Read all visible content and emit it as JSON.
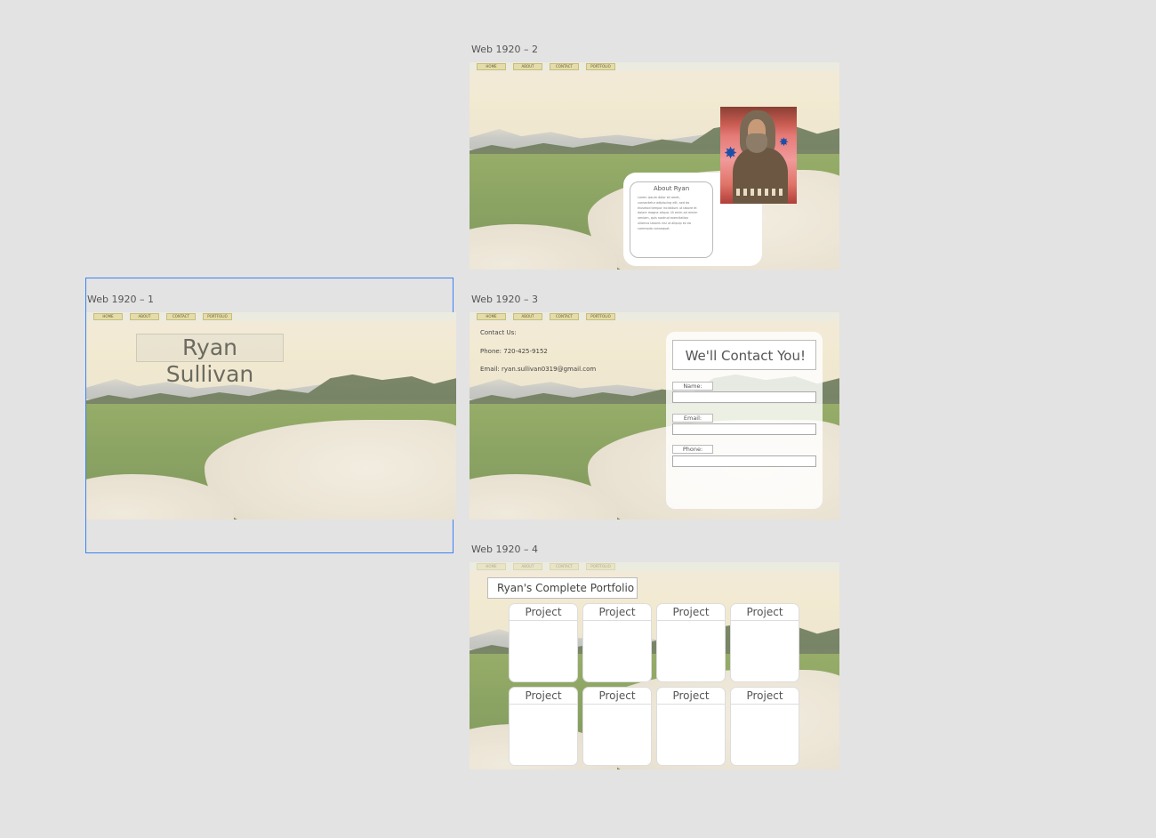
{
  "artboards": {
    "web1": {
      "label": "Web 1920 – 1",
      "hero_name": "Ryan Sullivan"
    },
    "web2": {
      "label": "Web 1920 – 2",
      "about_title": "About Ryan",
      "about_body": "Lorem ipsum dolor sit amet, consectetur adipiscing elit, sed do eiusmod tempor incididunt ut labore et dolore magna aliqua. Ut enim ad minim veniam, quis nostrud exercitation ullamco laboris nisi ut aliquip ex ea commodo consequat."
    },
    "web3": {
      "label": "Web 1920 – 3",
      "contact_heading": "Contact Us:",
      "phone": "Phone: 720-425-9152",
      "email": "Email: ryan.sullivan0319@gmail.com",
      "form_title": "We'll Contact You!",
      "fields": {
        "name": "Name:",
        "email": "Email:",
        "phone": "Phone:"
      }
    },
    "web4": {
      "label": "Web 1920 – 4",
      "portfolio_title": "Ryan's Complete Portfolio",
      "project_label": "Project"
    }
  },
  "nav": {
    "home": "HOME",
    "about": "ABOUT",
    "contact": "CONTACT",
    "portfolio": "PORTFOLIO"
  },
  "colors": {
    "canvas_bg": "#e3e3e3",
    "selection": "#3b82f6",
    "nav_button": "#e4dcaa"
  }
}
